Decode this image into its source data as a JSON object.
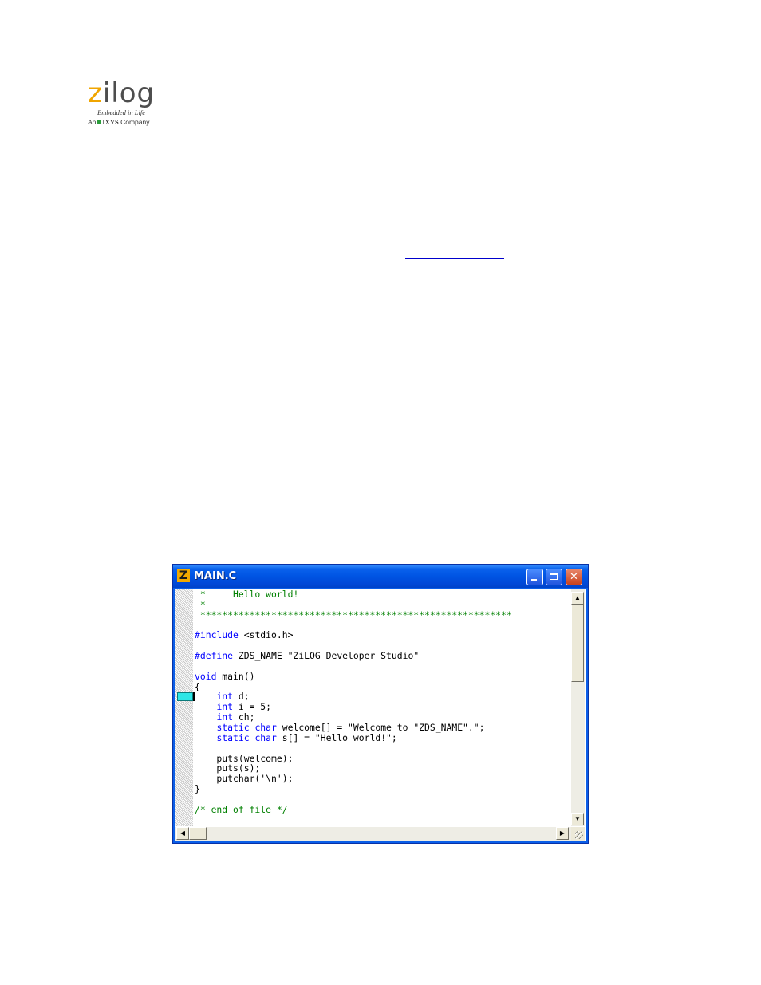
{
  "logo": {
    "word_first": "z",
    "word_rest": "ilog",
    "tagline": "Embedded in Life",
    "company_prefix": "An",
    "company_name": "IXYS",
    "company_suffix": "Company",
    "brand_color": "#f0a500",
    "accent_color": "#2a9c3a"
  },
  "window": {
    "title": "MAIN.C",
    "icon_letter": "Z",
    "icon": "zds-app-icon",
    "title_color": "#0054e3",
    "close_color": "#c8421d"
  },
  "code": {
    "lines": [
      [
        {
          "t": " *     Hello world!",
          "c": "cmt"
        }
      ],
      [
        {
          "t": " *",
          "c": "cmt"
        }
      ],
      [
        {
          "t": " *********************************************************",
          "c": "cmt"
        }
      ],
      [
        {
          "t": "",
          "c": ""
        }
      ],
      [
        {
          "t": "#include",
          "c": "kw"
        },
        {
          "t": " <stdio.h>",
          "c": ""
        }
      ],
      [
        {
          "t": "",
          "c": ""
        }
      ],
      [
        {
          "t": "#define",
          "c": "kw"
        },
        {
          "t": " ZDS_NAME \"ZiLOG Developer Studio\"",
          "c": ""
        }
      ],
      [
        {
          "t": "",
          "c": ""
        }
      ],
      [
        {
          "t": "void",
          "c": "kw"
        },
        {
          "t": " main()",
          "c": ""
        }
      ],
      [
        {
          "t": "{",
          "c": ""
        }
      ],
      [
        {
          "t": "    ",
          "c": ""
        },
        {
          "t": "int",
          "c": "kw"
        },
        {
          "t": " d;",
          "c": ""
        }
      ],
      [
        {
          "t": "    ",
          "c": ""
        },
        {
          "t": "int",
          "c": "kw"
        },
        {
          "t": " i = 5;",
          "c": ""
        }
      ],
      [
        {
          "t": "    ",
          "c": ""
        },
        {
          "t": "int",
          "c": "kw"
        },
        {
          "t": " ch;",
          "c": ""
        }
      ],
      [
        {
          "t": "    ",
          "c": ""
        },
        {
          "t": "static",
          "c": "kw"
        },
        {
          "t": " ",
          "c": ""
        },
        {
          "t": "char",
          "c": "kw"
        },
        {
          "t": " welcome[] = \"Welcome to \"ZDS_NAME\".\";",
          "c": ""
        }
      ],
      [
        {
          "t": "    ",
          "c": ""
        },
        {
          "t": "static",
          "c": "kw"
        },
        {
          "t": " ",
          "c": ""
        },
        {
          "t": "char",
          "c": "kw"
        },
        {
          "t": " s[] = \"Hello world!\";",
          "c": ""
        }
      ],
      [
        {
          "t": "",
          "c": ""
        }
      ],
      [
        {
          "t": "    puts(welcome);",
          "c": ""
        }
      ],
      [
        {
          "t": "    puts(s);",
          "c": ""
        }
      ],
      [
        {
          "t": "    putchar('\\n');",
          "c": ""
        }
      ],
      [
        {
          "t": "}",
          "c": ""
        }
      ],
      [
        {
          "t": "",
          "c": ""
        }
      ],
      [
        {
          "t": "/* end of file */",
          "c": "cmt"
        }
      ]
    ],
    "comment_color": "#008000",
    "keyword_color": "#0000ff",
    "breakpoint_marker_color": "#2ee6e6"
  },
  "scrollbars": {
    "up_icon": "arrow-up-icon",
    "down_icon": "arrow-down-icon",
    "left_icon": "arrow-left-icon",
    "right_icon": "arrow-right-icon"
  }
}
